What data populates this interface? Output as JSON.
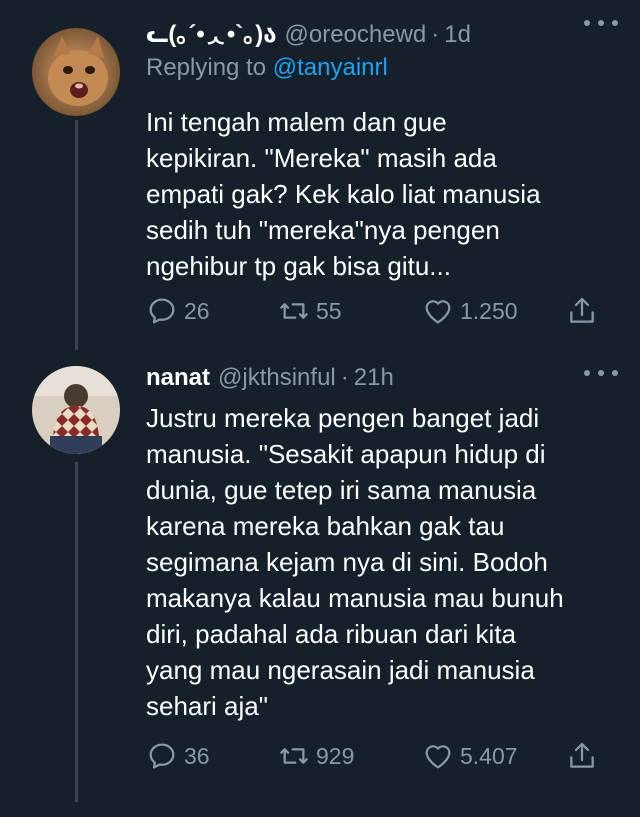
{
  "tweets": [
    {
      "name": "ᓚ(｡´•ᆺ•`｡)ა",
      "handle": "@oreochewd",
      "time": "1d",
      "replying_label": "Replying to ",
      "replying_to": "@tanyainrl",
      "text": "Ini tengah malem dan gue\nkepikiran. \"Mereka\" masih ada\nempati gak? Kek kalo liat manusia\nsedih tuh \"mereka\"nya pengen\nngehibur tp gak bisa gitu...",
      "replies": "26",
      "retweets": "55",
      "likes": "1.250"
    },
    {
      "name": "nanat",
      "handle": "@jkthsinful",
      "time": "21h",
      "text": "Justru mereka pengen banget jadi\nmanusia. \"Sesakit apapun hidup di\ndunia, gue tetep iri sama manusia\nkarena mereka bahkan gak tau\nsegimana kejam nya di sini. Bodoh\nmakanya kalau manusia mau bunuh\ndiri, padahal ada ribuan dari kita\nyang mau ngerasain jadi manusia\nsehari aja\"",
      "replies": "36",
      "retweets": "929",
      "likes": "5.407"
    }
  ],
  "dot_separator": "·",
  "colors": {
    "background": "#15202b",
    "secondary_text": "#8899a6",
    "link": "#1da1f2",
    "thread_line": "#38444d"
  },
  "icons": [
    "reply-icon",
    "retweet-icon",
    "like-icon",
    "share-icon",
    "more-icon"
  ]
}
